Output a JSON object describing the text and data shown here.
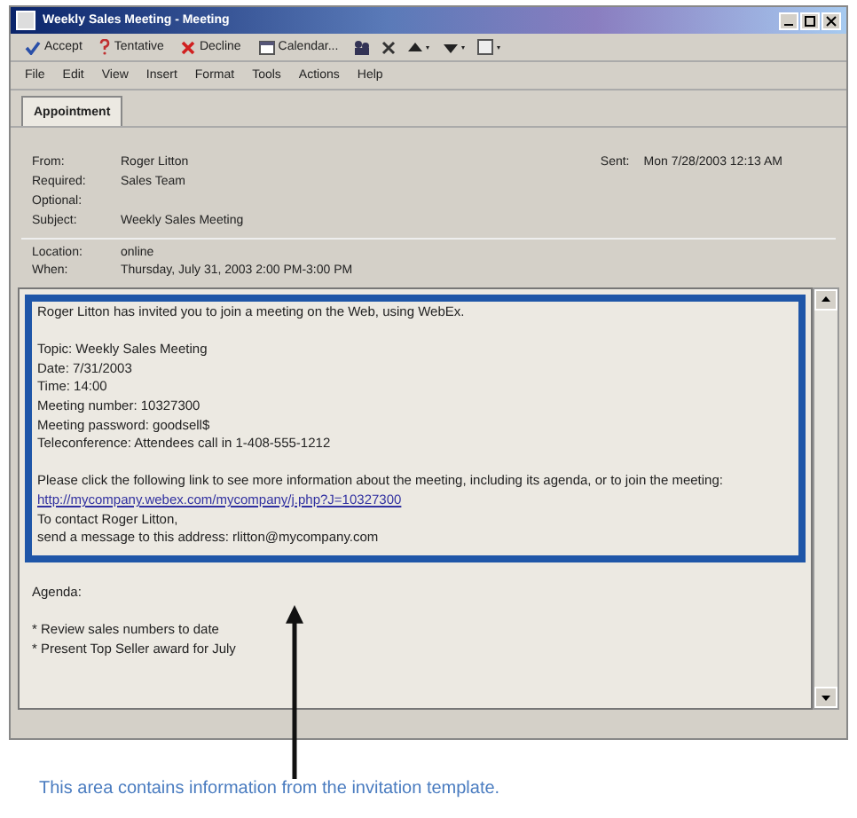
{
  "window": {
    "title": "Weekly Sales Meeting - Meeting"
  },
  "toolbar": [
    {
      "kind": "accept",
      "label": "Accept"
    },
    {
      "kind": "tentative",
      "label": "Tentative"
    },
    {
      "kind": "decline",
      "label": "Decline"
    },
    {
      "kind": "calendar",
      "label": "Calendar..."
    }
  ],
  "menu": [
    "File",
    "Edit",
    "View",
    "Insert",
    "Format",
    "Tools",
    "Actions",
    "Help"
  ],
  "tabs": [
    {
      "label": "Appointment",
      "selected": true
    }
  ],
  "header": {
    "fields": [
      {
        "label": "From:",
        "value": "Roger Litton"
      },
      {
        "label": "Required:",
        "value": "Sales Team"
      },
      {
        "label": "Optional:"
      },
      {
        "label": "Subject:",
        "value": "Weekly Sales Meeting"
      }
    ],
    "sent": {
      "label": "Sent:",
      "value": "Mon 7/28/2003 12:13 AM"
    }
  },
  "meeting_fields": [
    {
      "label": "Location:",
      "value": "online"
    },
    {
      "label": "When:",
      "value": "Thursday, July 31, 2003 2:00 PM-3:00 PM"
    }
  ],
  "invitation": [
    {
      "kind": "text",
      "text": "Roger Litton has invited you to join a meeting on the Web, using WebEx."
    },
    {
      "kind": "gap"
    },
    {
      "kind": "text",
      "text": "Topic: Weekly Sales Meeting"
    },
    {
      "kind": "text",
      "text": "Date: 7/31/2003"
    },
    {
      "kind": "text",
      "text": "Time: 14:00"
    },
    {
      "kind": "text",
      "text": "Meeting number: 10327300"
    },
    {
      "kind": "text",
      "text": "Meeting password: goodsell$"
    },
    {
      "kind": "text",
      "text": "Teleconference: Attendees call in 1-408-555-1212"
    },
    {
      "kind": "gap"
    },
    {
      "kind": "text",
      "text": "Please click the following link to see more information about the meeting, including its agenda, or to join the meeting:"
    },
    {
      "kind": "link",
      "text": "http://mycompany.webex.com/mycompany/j.php?J=10327300"
    },
    {
      "kind": "text",
      "text": "To contact Roger Litton,"
    },
    {
      "kind": "text",
      "text": "send a message to this address: rlitton@mycompany.com"
    }
  ],
  "agenda": [
    {
      "kind": "text",
      "text": "Agenda:"
    },
    {
      "kind": "gap"
    },
    {
      "kind": "text",
      "text": "* Review sales numbers to date"
    },
    {
      "kind": "text",
      "text": "* Present Top Seller award for July"
    }
  ],
  "caption": "This area contains information from the invitation template."
}
